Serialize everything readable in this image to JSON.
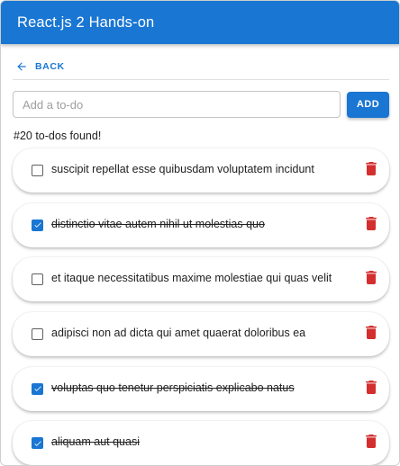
{
  "appbar": {
    "title": "React.js 2 Hands-on"
  },
  "nav": {
    "back_label": "BACK"
  },
  "form": {
    "placeholder": "Add a to-do",
    "value": "",
    "add_label": "ADD"
  },
  "summary": {
    "count_text": "#20 to-dos found!"
  },
  "todos": [
    {
      "text": "suscipit repellat esse quibusdam voluptatem incidunt",
      "completed": false
    },
    {
      "text": "distinctio vitae autem nihil ut molestias quo",
      "completed": true
    },
    {
      "text": "et itaque necessitatibus maxime molestiae qui quas velit",
      "completed": false
    },
    {
      "text": "adipisci non ad dicta qui amet quaerat doloribus ea",
      "completed": false
    },
    {
      "text": "voluptas quo tenetur perspiciatis explicabo natus",
      "completed": true
    },
    {
      "text": "aliquam aut quasi",
      "completed": true
    }
  ],
  "icons": {
    "back": "arrow-left-icon",
    "delete": "trash-icon",
    "check": "check-icon"
  },
  "colors": {
    "primary": "#1976d2",
    "delete": "#d32f2f"
  }
}
